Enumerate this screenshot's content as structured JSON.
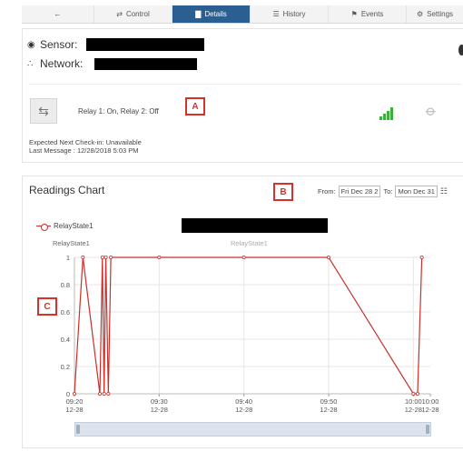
{
  "tabs": [
    {
      "id": "back",
      "label": "",
      "icon": "back-arrow-icon"
    },
    {
      "id": "control",
      "label": "Control",
      "icon": "control-icon"
    },
    {
      "id": "details",
      "label": "Details",
      "icon": "chart-icon",
      "active": true
    },
    {
      "id": "history",
      "label": "History",
      "icon": "list-icon"
    },
    {
      "id": "events",
      "label": "Events",
      "icon": "events-icon"
    },
    {
      "id": "settings",
      "label": "Settings",
      "icon": "gear-icon"
    }
  ],
  "device": {
    "sensor_label": "Sensor:",
    "network_label": "Network:",
    "relay_status": "Relay 1: On, Relay 2: Off",
    "checkin": "Expected Next Check-in: Unavailable",
    "last_message": "Last Message : 12/28/2018 5:03 PM"
  },
  "annotations": {
    "a": "A",
    "b": "B",
    "c": "C"
  },
  "chart_panel": {
    "title": "Readings Chart",
    "from_label": "From:",
    "from_value": "Fri Dec 28 2",
    "to_label": "To:",
    "to_value": "Mon Dec 31"
  },
  "colors": {
    "accent": "#2c5f91",
    "series": "#c9302c",
    "signal": "#3cae3c"
  },
  "chart_data": {
    "type": "line",
    "series": [
      {
        "name": "RelayState1",
        "points": [
          [
            "09:20",
            0
          ],
          [
            "09:21",
            1
          ],
          [
            "09:23",
            0
          ],
          [
            "09:23.3",
            1
          ],
          [
            "09:23.5",
            0
          ],
          [
            "09:23.7",
            1
          ],
          [
            "09:24",
            0
          ],
          [
            "09:24.3",
            1
          ],
          [
            "09:30",
            1
          ],
          [
            "09:40",
            1
          ],
          [
            "09:50",
            1
          ],
          [
            "10:00",
            0
          ],
          [
            "10:00.5",
            0
          ],
          [
            "10:01",
            1
          ]
        ]
      }
    ],
    "x_ticks": [
      {
        "time": "09:20",
        "date": "12-28"
      },
      {
        "time": "09:30",
        "date": "12-28"
      },
      {
        "time": "09:40",
        "date": "12-28"
      },
      {
        "time": "09:50",
        "date": "12-28"
      },
      {
        "time": "10:00",
        "date": "12-28"
      },
      {
        "time": "10:00",
        "date": "12-28"
      }
    ],
    "y_ticks": [
      "1",
      "0.8",
      "0.6",
      "0.4",
      "0.2",
      "0"
    ],
    "ylim": [
      0,
      1
    ],
    "xlim_minutes": [
      0,
      42
    ],
    "series_labels": [
      "RelayState1",
      "RelayState1"
    ],
    "grid": true,
    "legend": "top-left"
  }
}
